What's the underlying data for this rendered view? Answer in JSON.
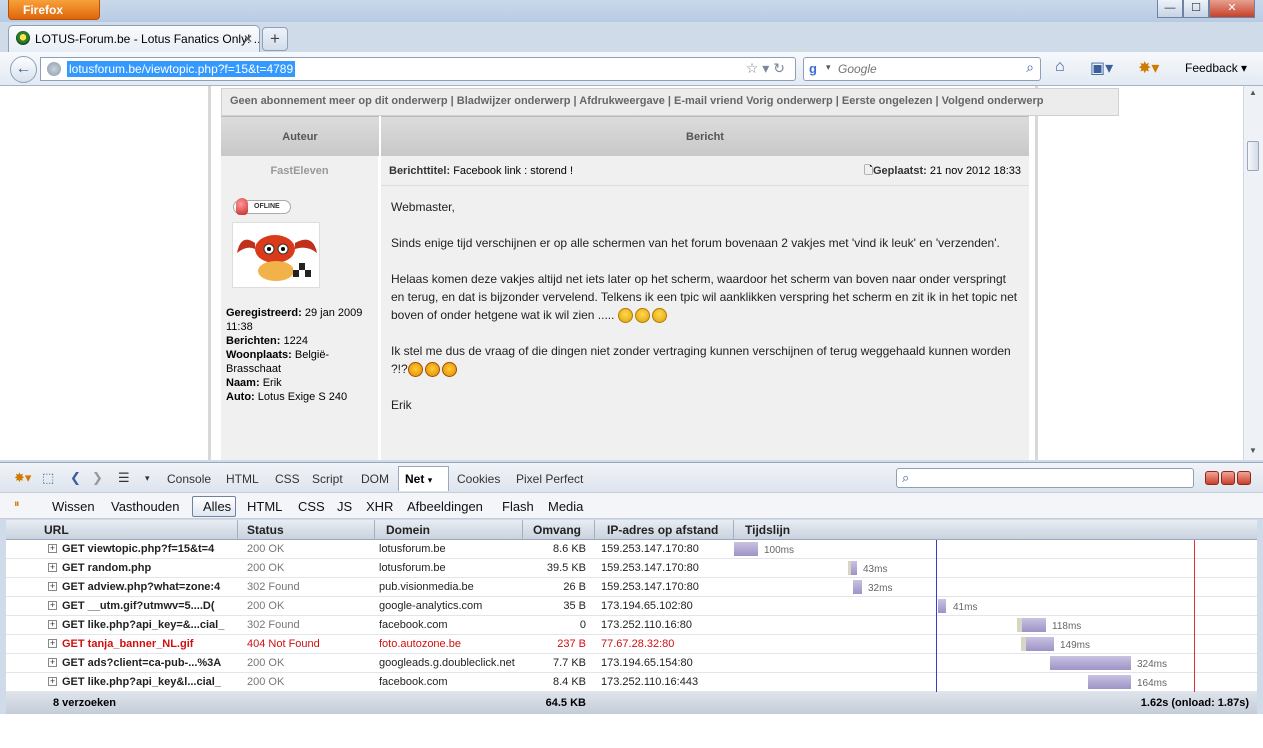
{
  "browser": {
    "app_button": "Firefox",
    "tab_title": "LOTUS-Forum.be - Lotus Fanatics Only! ...",
    "tab_close": "✕",
    "newtab": "+",
    "url": "lotusforum.be/viewtopic.php?f=15&t=4789",
    "search_engine": "g",
    "search_placeholder": "Google",
    "feedback_label": "Feedback",
    "win_min": "—",
    "win_max": "☐",
    "win_close": "✕"
  },
  "forum": {
    "topic_links": "Geen abonnement meer op dit onderwerp | Bladwijzer onderwerp | Afdrukweergave | E-mail vriend Vorig onderwerp | Eerste ongelezen | Volgend onderwerp",
    "col_author": "Auteur",
    "col_message": "Bericht",
    "author_name": "FastEleven",
    "subject_label": "Berichttitel:",
    "subject": "Facebook link : storend !",
    "posted_label": "Geplaatst:",
    "posted_date": "21 nov 2012 18:33",
    "offline": "OFLINE",
    "author_info": [
      {
        "label": "Geregistreerd:",
        "value": "29 jan 2009 11:38"
      },
      {
        "label": "Berichten:",
        "value": "1224"
      },
      {
        "label": "Woonplaats:",
        "value": "België-Brasschaat"
      },
      {
        "label": "Naam:",
        "value": "Erik"
      },
      {
        "label": "Auto:",
        "value": "Lotus Exige S 240"
      }
    ],
    "message": {
      "p1": "Webmaster,",
      "p2": "Sinds enige tijd verschijnen er op alle schermen van het forum bovenaan 2 vakjes met 'vind ik leuk' en 'verzenden'.",
      "p3": "Helaas komen deze vakjes altijd net iets later op het scherm, waardoor het scherm van boven naar onder verspringt en terug, en dat is bijzonder vervelend. Telkens ik een tpic wil aanklikken verspring het scherm en zit ik in het topic net boven of onder hetgene wat ik wil zien .....",
      "p4": "Ik stel me dus de vraag of die dingen niet zonder vertraging kunnen verschijnen of terug weggehaald kunnen worden ?!?",
      "p5": "Erik"
    }
  },
  "firebug": {
    "tabs": [
      "Console",
      "HTML",
      "CSS",
      "Script",
      "DOM",
      "Net",
      "Cookies",
      "Pixel Perfect"
    ],
    "filters": [
      "Wissen",
      "Vasthouden",
      "Alles",
      "HTML",
      "CSS",
      "JS",
      "XHR",
      "Afbeeldingen",
      "Flash",
      "Media"
    ],
    "columns": {
      "url": "URL",
      "status": "Status",
      "domain": "Domein",
      "size": "Omvang",
      "ip": "IP-adres op afstand",
      "timeline": "Tijdslijn"
    },
    "requests": [
      {
        "url": "GET viewtopic.php?f=15&t=4",
        "status": "200 OK",
        "domain": "lotusforum.be",
        "size": "8.6 KB",
        "ip": "159.253.147.170:80",
        "time": "100ms",
        "error": false
      },
      {
        "url": "GET random.php",
        "status": "200 OK",
        "domain": "lotusforum.be",
        "size": "39.5 KB",
        "ip": "159.253.147.170:80",
        "time": "43ms",
        "error": false
      },
      {
        "url": "GET adview.php?what=zone:4",
        "status": "302 Found",
        "domain": "pub.visionmedia.be",
        "size": "26 B",
        "ip": "159.253.147.170:80",
        "time": "32ms",
        "error": false
      },
      {
        "url": "GET __utm.gif?utmwv=5....D(",
        "status": "200 OK",
        "domain": "google-analytics.com",
        "size": "35 B",
        "ip": "173.194.65.102:80",
        "time": "41ms",
        "error": false
      },
      {
        "url": "GET like.php?api_key=&...cial_",
        "status": "302 Found",
        "domain": "facebook.com",
        "size": "0",
        "ip": "173.252.110.16:80",
        "time": "118ms",
        "error": false
      },
      {
        "url": "GET tanja_banner_NL.gif",
        "status": "404 Not Found",
        "domain": "foto.autozone.be",
        "size": "237 B",
        "ip": "77.67.28.32:80",
        "time": "149ms",
        "error": true
      },
      {
        "url": "GET ads?client=ca-pub-...%3A",
        "status": "200 OK",
        "domain": "googleads.g.doubleclick.net",
        "size": "7.7 KB",
        "ip": "173.194.65.154:80",
        "time": "324ms",
        "error": false
      },
      {
        "url": "GET like.php?api_key&l...cial_",
        "status": "200 OK",
        "domain": "facebook.com",
        "size": "8.4 KB",
        "ip": "173.252.110.16:443",
        "time": "164ms",
        "error": false
      }
    ],
    "footer": {
      "count": "8 verzoeken",
      "total_size": "64.5 KB",
      "total_time": "1.62s (onload: 1.87s)"
    }
  }
}
